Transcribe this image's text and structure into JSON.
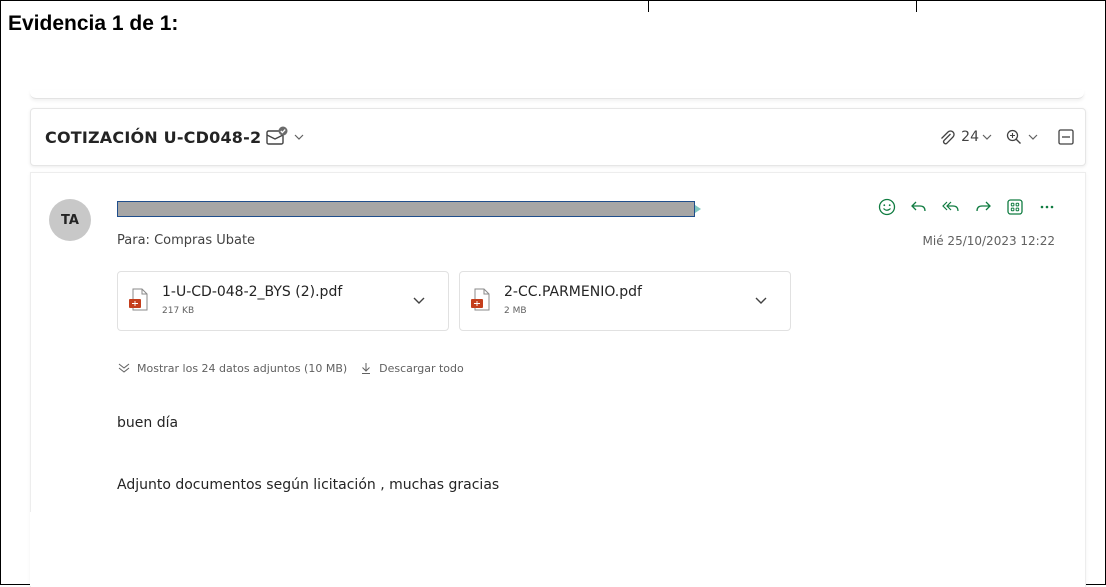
{
  "document": {
    "title": "Evidencia 1 de 1:"
  },
  "email": {
    "subject": "COTIZACIÓN U-CD048-2",
    "attachment_count": "24",
    "sender_initials": "TA",
    "to_label": "Para:",
    "to_value": "Compras Ubate",
    "date": "Mié 25/10/2023 12:22",
    "attachments": [
      {
        "name": "1-U-CD-048-2_BYS (2).pdf",
        "size": "217 KB"
      },
      {
        "name": "2-CC.PARMENIO.pdf",
        "size": "2 MB"
      }
    ],
    "show_all_label": "Mostrar los 24 datos adjuntos (10 MB)",
    "download_all_label": "Descargar todo",
    "body_greeting": "buen día",
    "body_text": "Adjunto documentos según licitación , muchas gracias"
  },
  "colors": {
    "accent_green": "#107c41",
    "icon_gray": "#424242",
    "pdf_red": "#c43e1c",
    "avatar_bg": "#c8c8c8",
    "redaction": "#a6a6a6"
  },
  "icons": {
    "subject_icon": "message-status-icon",
    "attach": "paperclip-icon",
    "zoom": "zoom-icon",
    "collapse": "collapse-panel-icon",
    "actions": [
      "emoji-icon",
      "reply-icon",
      "reply-all-icon",
      "forward-icon",
      "apps-icon",
      "more-icon"
    ]
  }
}
